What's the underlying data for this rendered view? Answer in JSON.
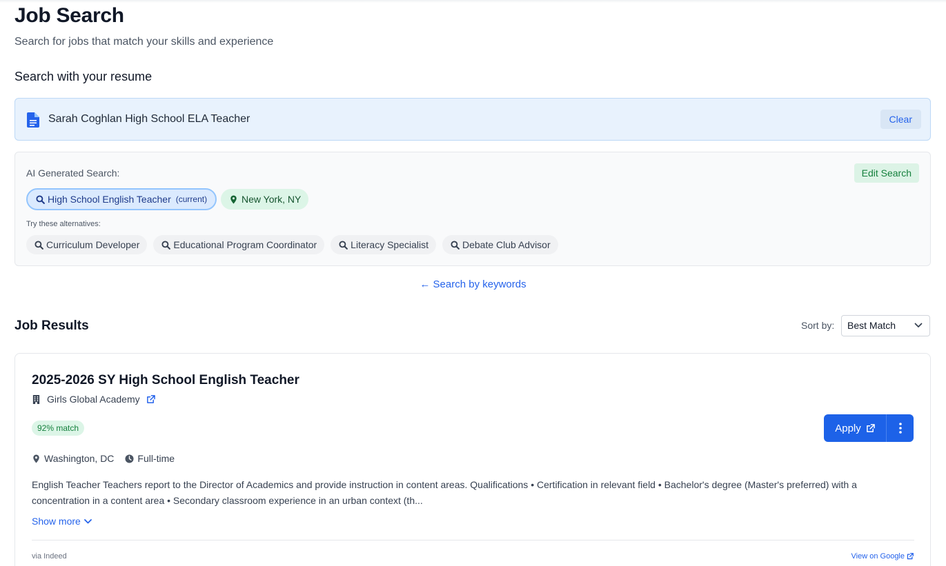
{
  "header": {
    "title": "Job Search",
    "subtitle": "Search for jobs that match your skills and experience"
  },
  "resume_section": {
    "heading": "Search with your resume",
    "resume_name": "Sarah Coghlan High School ELA Teacher",
    "clear_label": "Clear"
  },
  "ai_search": {
    "label": "AI Generated Search:",
    "edit_label": "Edit Search",
    "current_query": "High School English Teacher",
    "current_tag": "(current)",
    "location": "New York, NY",
    "alternatives_label": "Try these alternatives:",
    "alternatives": [
      "Curriculum Developer",
      "Educational Program Coordinator",
      "Literacy Specialist",
      "Debate Club Advisor"
    ]
  },
  "keyword_link": "← Search by keywords",
  "results": {
    "heading": "Job Results",
    "sort_label": "Sort by:",
    "sort_value": "Best Match"
  },
  "job": {
    "title": "2025-2026 SY High School English Teacher",
    "company": "Girls Global Academy",
    "match": "92% match",
    "apply_label": "Apply",
    "location": "Washington, DC",
    "job_type": "Full-time",
    "description": "English Teacher Teachers report to the Director of Academics and provide instruction in content areas. Qualifications • Certification in relevant field • Bachelor's degree (Master's preferred) with a concentration in a content area • Secondary classroom experience in an urban context (th...",
    "show_more_label": "Show more",
    "source": "via Indeed",
    "view_google_label": "View on Google"
  },
  "colors": {
    "accent": "#2563eb",
    "apply_button": "#1d62e8",
    "match_badge_bg": "#dcf5e7",
    "resume_box_bg": "#e8f2fd"
  },
  "icons": [
    "document-icon",
    "search-icon",
    "map-pin-icon",
    "building-icon",
    "external-link-icon",
    "clock-icon",
    "chevron-down-icon",
    "more-vertical-icon"
  ]
}
